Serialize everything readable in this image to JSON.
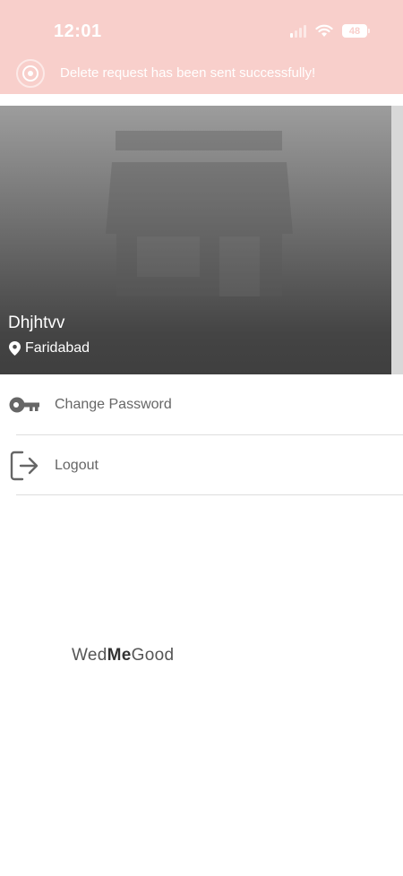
{
  "status_bar": {
    "time": "12:01",
    "battery": "48"
  },
  "toast": {
    "message": "Delete request has been sent successfully!"
  },
  "vendor": {
    "name": "Dhjhtvv",
    "location": "Faridabad"
  },
  "menu": {
    "items": [
      {
        "label": "Change Password",
        "icon": "key-icon"
      },
      {
        "label": "Logout",
        "icon": "logout-icon"
      }
    ]
  },
  "brand": {
    "part1": "Wed",
    "part2": "Me",
    "part3": "Good"
  },
  "colors": {
    "banner": "#f8cfcb",
    "text_muted": "#666666"
  }
}
